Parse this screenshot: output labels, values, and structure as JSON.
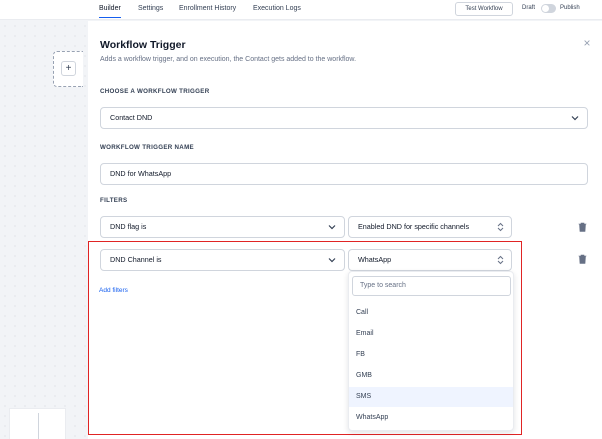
{
  "topnav": {
    "tabs": [
      "Builder",
      "Settings",
      "Enrollment History",
      "Execution Logs"
    ],
    "test_workflow": "Test Workflow",
    "draft": "Draft",
    "publish": "Publish"
  },
  "canvas": {
    "add_symbol": "+"
  },
  "panel": {
    "title": "Workflow Trigger",
    "description": "Adds a workflow trigger, and on execution, the Contact gets added to the workflow.",
    "choose_label": "CHOOSE A WORKFLOW TRIGGER",
    "trigger_value": "Contact DND",
    "name_label": "WORKFLOW TRIGGER NAME",
    "name_value": "DND for WhatsApp",
    "filters_label": "FILTERS",
    "filters": [
      {
        "field": "DND flag is",
        "value": "Enabled DND for specific channels"
      },
      {
        "field": "DND Channel is",
        "value": "WhatsApp"
      }
    ],
    "add_filter": "Add filters"
  },
  "dropdown": {
    "search_placeholder": "Type to search",
    "options": [
      "Call",
      "Email",
      "FB",
      "GMB",
      "SMS",
      "WhatsApp"
    ],
    "highlighted": "SMS"
  }
}
